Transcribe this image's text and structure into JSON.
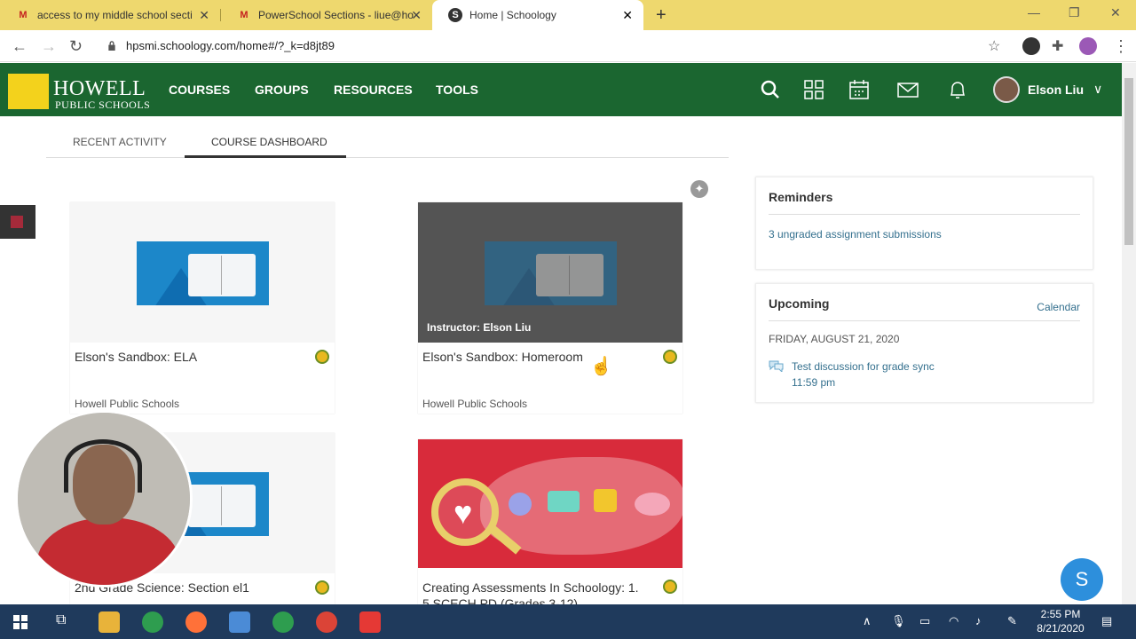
{
  "browser": {
    "tabs": [
      {
        "label": "access to my middle school secti",
        "icon": "gmail-icon"
      },
      {
        "label": "PowerSchool Sections - liue@ho",
        "icon": "gmail-icon"
      },
      {
        "label": "Home | Schoology",
        "icon": "schoology-icon"
      }
    ],
    "url": "hpsmi.schoology.com/home#/?_k=d8jt89"
  },
  "header": {
    "logo_line1": "HOWELL",
    "logo_line2": "PUBLIC SCHOOLS",
    "nav": [
      "COURSES",
      "GROUPS",
      "RESOURCES",
      "TOOLS"
    ],
    "user_name": "Elson Liu"
  },
  "subtabs": [
    "RECENT ACTIVITY",
    "COURSE DASHBOARD"
  ],
  "courses": [
    {
      "title": "Elson's Sandbox: ELA",
      "org": "Howell Public Schools"
    },
    {
      "title": "Elson's Sandbox: Homeroom",
      "org": "Howell Public Schools",
      "instructor": "Instructor: Elson Liu"
    },
    {
      "title": "2nd Grade Science: Section el1"
    },
    {
      "title": "Creating Assessments In Schoology: 1.",
      "title_line2": "5 SCECH PD (Grades 3-12)"
    }
  ],
  "reminders": {
    "title": "Reminders",
    "item": "3 ungraded assignment submissions"
  },
  "upcoming": {
    "title": "Upcoming",
    "calendar_link": "Calendar",
    "date": "FRIDAY, AUGUST 21, 2020",
    "event": "Test discussion for grade sync",
    "time": "11:59 pm"
  },
  "taskbar": {
    "time": "2:55 PM",
    "date": "8/21/2020"
  },
  "colors": {
    "header_bg": "#1b6630",
    "tabbar_bg": "#eed86e",
    "link": "#34708e",
    "logo_yellow": "#f3d21c"
  }
}
